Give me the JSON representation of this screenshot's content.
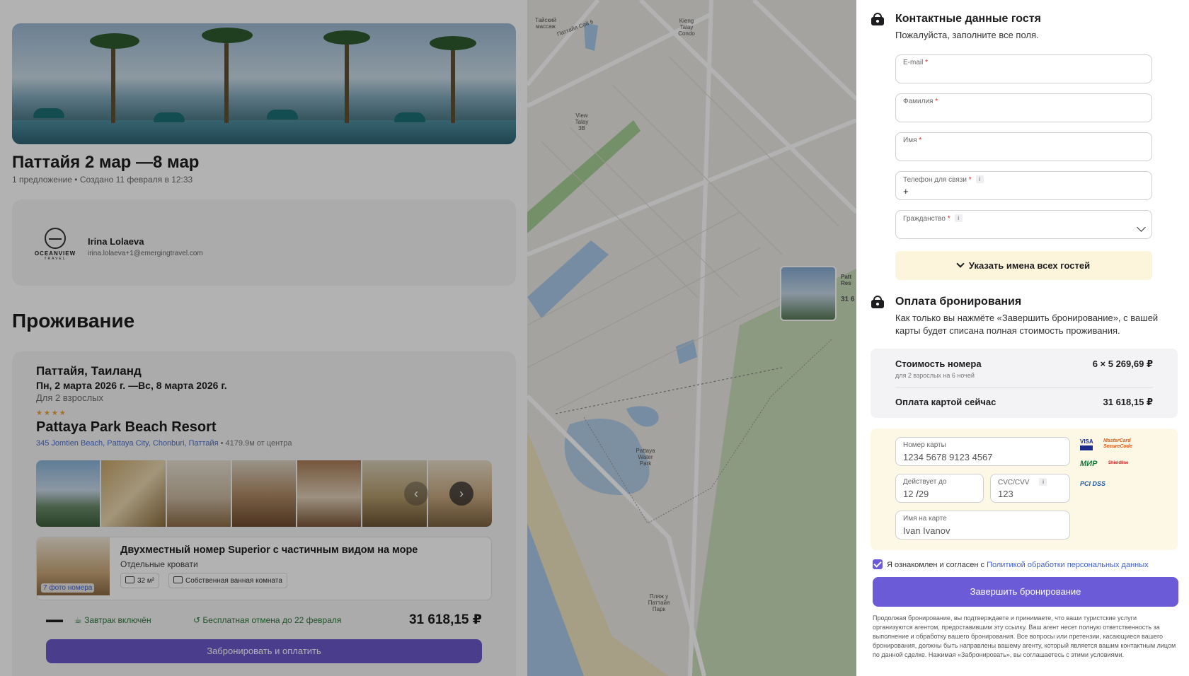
{
  "trip": {
    "title": "Паттайя 2 мар —8 мар",
    "meta": "1 предложение • Создано 11 февраля в 12:33"
  },
  "agent": {
    "logo_text": "OCEANVIEW",
    "logo_sub": "TRAVEL",
    "name": "Irina Lolaeva",
    "email": "irina.lolaeva+1@emergingtravel.com"
  },
  "accommodation": {
    "section_title": "Проживание",
    "city": "Паттайя, Таиланд",
    "dates": "Пн, 2 марта 2026 г. —Вс, 8 марта 2026 г.",
    "guests": "Для 2 взрослых",
    "stars": "★★★★",
    "hotel_name": "Pattaya Park Beach Resort",
    "address": "345 Jomtien Beach, Pattaya City, Chonburi, Паттайя",
    "distance": " • 4179.9м от центра",
    "room": {
      "title": "Двухместный номер Superior с частичным видом на море",
      "beds": "Отдельные кровати",
      "photos_label": "7 фото номера",
      "area": "32 м²",
      "bathroom": "Собственная ванная комната"
    },
    "offer": {
      "breakfast": "Завтрак включён",
      "cancellation": "Бесплатная отмена до 22 февраля",
      "price": "31 618,15 ₽",
      "book_label": "Забронировать и оплатить"
    }
  },
  "map": {
    "labels": [
      "Тайский массаж",
      "Паттайя Сой 6",
      "Kieng Talay Condo",
      "View Talay 3B",
      "Pattaya Water Park",
      "Пляж у Паттайя Парк"
    ],
    "marker_title": "Patt Res",
    "marker_price": "31 6"
  },
  "contact": {
    "title": "Контактные данные гостя",
    "subtitle": "Пожалуйста, заполните все поля.",
    "fields": {
      "email": {
        "label": "E-mail",
        "value": ""
      },
      "surname": {
        "label": "Фамилия",
        "value": ""
      },
      "name": {
        "label": "Имя",
        "value": ""
      },
      "phone": {
        "label": "Телефон для связи",
        "value": "+"
      },
      "citizenship": {
        "label": "Гражданство",
        "value": ""
      }
    },
    "req_mark": "*",
    "info_mark": "i",
    "guests_button": "Указать имена всех гостей"
  },
  "payment": {
    "title": "Оплата бронирования",
    "subtitle": "Как только вы нажмёте «Завершить бронирование», с вашей карты будет списана полная стоимость проживания.",
    "room_cost_label": "Стоимость номера",
    "room_cost_sub": "для 2 взрослых на 6 ночей",
    "room_cost_value": "6 × 5 269,69 ₽",
    "pay_now_label": "Оплата картой сейчас",
    "pay_now_value": "31 618,15 ₽",
    "card_number": {
      "label": "Номер карты",
      "placeholder": "1234 5678 9123 4567"
    },
    "expiry": {
      "label": "Действует до",
      "month": "12",
      "separator": "/",
      "year": "29"
    },
    "cvc": {
      "label": "CVC/CVV",
      "placeholder": "123"
    },
    "holder": {
      "label": "Имя на карте",
      "placeholder": "Ivan Ivanov"
    },
    "logos": {
      "visa": "VISA",
      "mastercard": "MasterCard SecureCode",
      "mir": "МИР",
      "shieldline": "Shieldline",
      "pci": "PCI DSS"
    }
  },
  "consent": {
    "text": "Я ознакомлен и согласен с ",
    "link": "Политикой обработки персональных данных"
  },
  "finish_label": "Завершить бронирование",
  "legal": "Продолжая бронирование, вы подтверждаете и принимаете, что ваши туристские услуги организуются агентом, предоставившим эту ссылку. Ваш агент несет полную ответственность за выполнение и обработку вашего бронирования. Все вопросы или претензии, касающиеся вашего бронирования, должны быть направлены вашему агенту, который является вашим контактным лицом по данной сделке. Нажимая «Забронировать», вы соглашаетесь с этими условиями."
}
